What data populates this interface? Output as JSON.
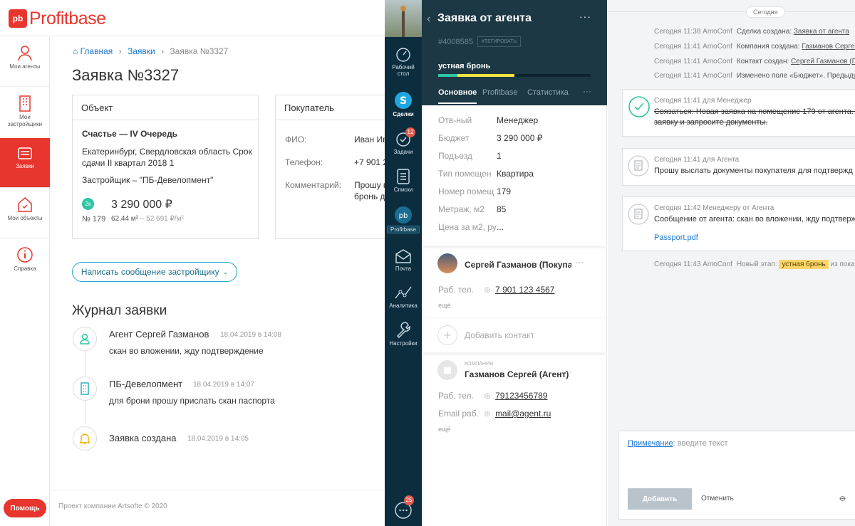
{
  "pb": {
    "logo_mark": "pb",
    "logo_text": "Profitbase",
    "side": [
      {
        "label": "Мои агенты"
      },
      {
        "label": "Мои застройщики"
      },
      {
        "label": "Заявки"
      },
      {
        "label": "Мои объекты"
      },
      {
        "label": "Справка"
      }
    ],
    "breadcrumb": {
      "home": "Главная",
      "requests": "Заявки",
      "current": "Заявка №3327"
    },
    "title": "Заявка №3327",
    "object": {
      "header": "Объект",
      "name": "Счастье — IV Очередь",
      "address1": "Екатеринбург, Свердловская область Срок",
      "address2": "сдачи II квартал 2018 1",
      "developer": "Застройщик – \"ПБ-Девелопмент\"",
      "rooms": "2к",
      "price": "3 290 000 ₽",
      "number": "№ 179",
      "area": "62.44 м²",
      "price_m2": "– 52 691 ₽/м²"
    },
    "buyer": {
      "header": "Покупатель",
      "fio_label": "ФИО:",
      "fio": "Иван Ив",
      "phone_label": "Телефон:",
      "phone": "+7 901 2",
      "comment_label": "Комментарий:",
      "comment1": "Прошу п",
      "comment2": "бронь д"
    },
    "write_btn": "Написать сообщение застройщику",
    "journal_title": "Журнал заявки",
    "journal": [
      {
        "title": "Агент Сергей Газманов",
        "date": "18.04.2019 в 14:08",
        "text": "скан во вложении, жду подтверждение",
        "icon": "user-icon"
      },
      {
        "title": "ПБ-Девелопмент",
        "date": "18.04.2019 в 14:07",
        "text": "для брони прошу прислать скан паспорта",
        "icon": "building-icon"
      },
      {
        "title": "Заявка создана",
        "date": "18.04.2019 в 14:05",
        "text": "",
        "icon": "bell-icon"
      }
    ],
    "help": "Помощь",
    "footer": "Проект компании Artsofte © 2020"
  },
  "nav": {
    "items": [
      {
        "label1": "Рабочий",
        "label2": "стол"
      },
      {
        "label1": "Сделки"
      },
      {
        "label1": "Задачи",
        "badge": "12"
      },
      {
        "label1": "Списки"
      },
      {
        "label1": "Profitbase"
      },
      {
        "label1": "Почта"
      },
      {
        "label1": "Аналитика"
      },
      {
        "label1": "Настройки"
      }
    ],
    "chat_badge": "25"
  },
  "card": {
    "title": "Заявка от агента",
    "id": "#4008585",
    "tag_btn": "#ТЕГИРОВАТЬ",
    "stage": "устная бронь",
    "stage_fill_pct": 0.5,
    "tabs": [
      "Основное",
      "Profitbase",
      "Статистика"
    ],
    "fields": [
      {
        "k": "Отв-ный",
        "v": "Менеджер"
      },
      {
        "k": "Бюджет",
        "v": "3 290 000 ₽"
      },
      {
        "k": "Подъезд",
        "v": "1"
      },
      {
        "k": "Тип помещен",
        "v": "Квартира"
      },
      {
        "k": "Номер помещ",
        "v": "179"
      },
      {
        "k": "Метраж, м2",
        "v": "85"
      },
      {
        "k": "Цена за м2, ру",
        "v": "..."
      }
    ],
    "contact1": {
      "name": "Сергей Газманов (Покупате.",
      "phone_label": "Раб. тел.",
      "phone": "7 901 123 4567",
      "more": "ещё"
    },
    "add_contact": "Добавить контакт",
    "company": {
      "caption": "КОМПАНИЯ",
      "name": "Газманов Сергей (Агент)",
      "phone_label": "Раб. тел.",
      "phone": "79123456789",
      "email_label": "Email раб.",
      "email": "mail@agent.ru",
      "more": "ещё"
    }
  },
  "feed": {
    "today": "Сегодня",
    "events": [
      {
        "meta": "Сегодня 11:38 AmoConf",
        "text": "Сделка создана: ",
        "link": "Заявка от агента"
      },
      {
        "meta": "Сегодня 11:41 AmoConf",
        "text": "Компания создана: ",
        "link": "Газманов Сергей (А"
      },
      {
        "meta": "Сегодня 11:41 AmoConf",
        "text": "Контакт создан: ",
        "link": "Сергей Газманов (Пок"
      },
      {
        "meta": "Сегодня 11:41 AmoConf",
        "text": "Изменено поле «Бюджет». Предыдуще",
        "link": ""
      }
    ],
    "task": {
      "meta": "Сегодня 11:41  для Менеджер",
      "line1": "Связаться: Новая заявка на помещение 179 от агента. В",
      "line2": "заявку и запросите документы."
    },
    "note1": {
      "meta": "Сегодня 11:41 для Агента",
      "text": "Прошу выслать документы покупателя для подтвержд"
    },
    "note2": {
      "meta": "Сегодня 11:42 Менеджеру от Агента",
      "text": "Сообщение от агента: скан во вложении, жду подтверж",
      "file": "Passport.pdf"
    },
    "stage_event": {
      "meta": "Сегодня 11:43 AmoConf",
      "text": "Новый этап:",
      "tag": "устная бронь",
      "tail": "из показ"
    },
    "compose": {
      "note_label": "Примечание",
      "placeholder": ": введите текст",
      "add": "Добавить",
      "cancel": "Отменить"
    }
  }
}
